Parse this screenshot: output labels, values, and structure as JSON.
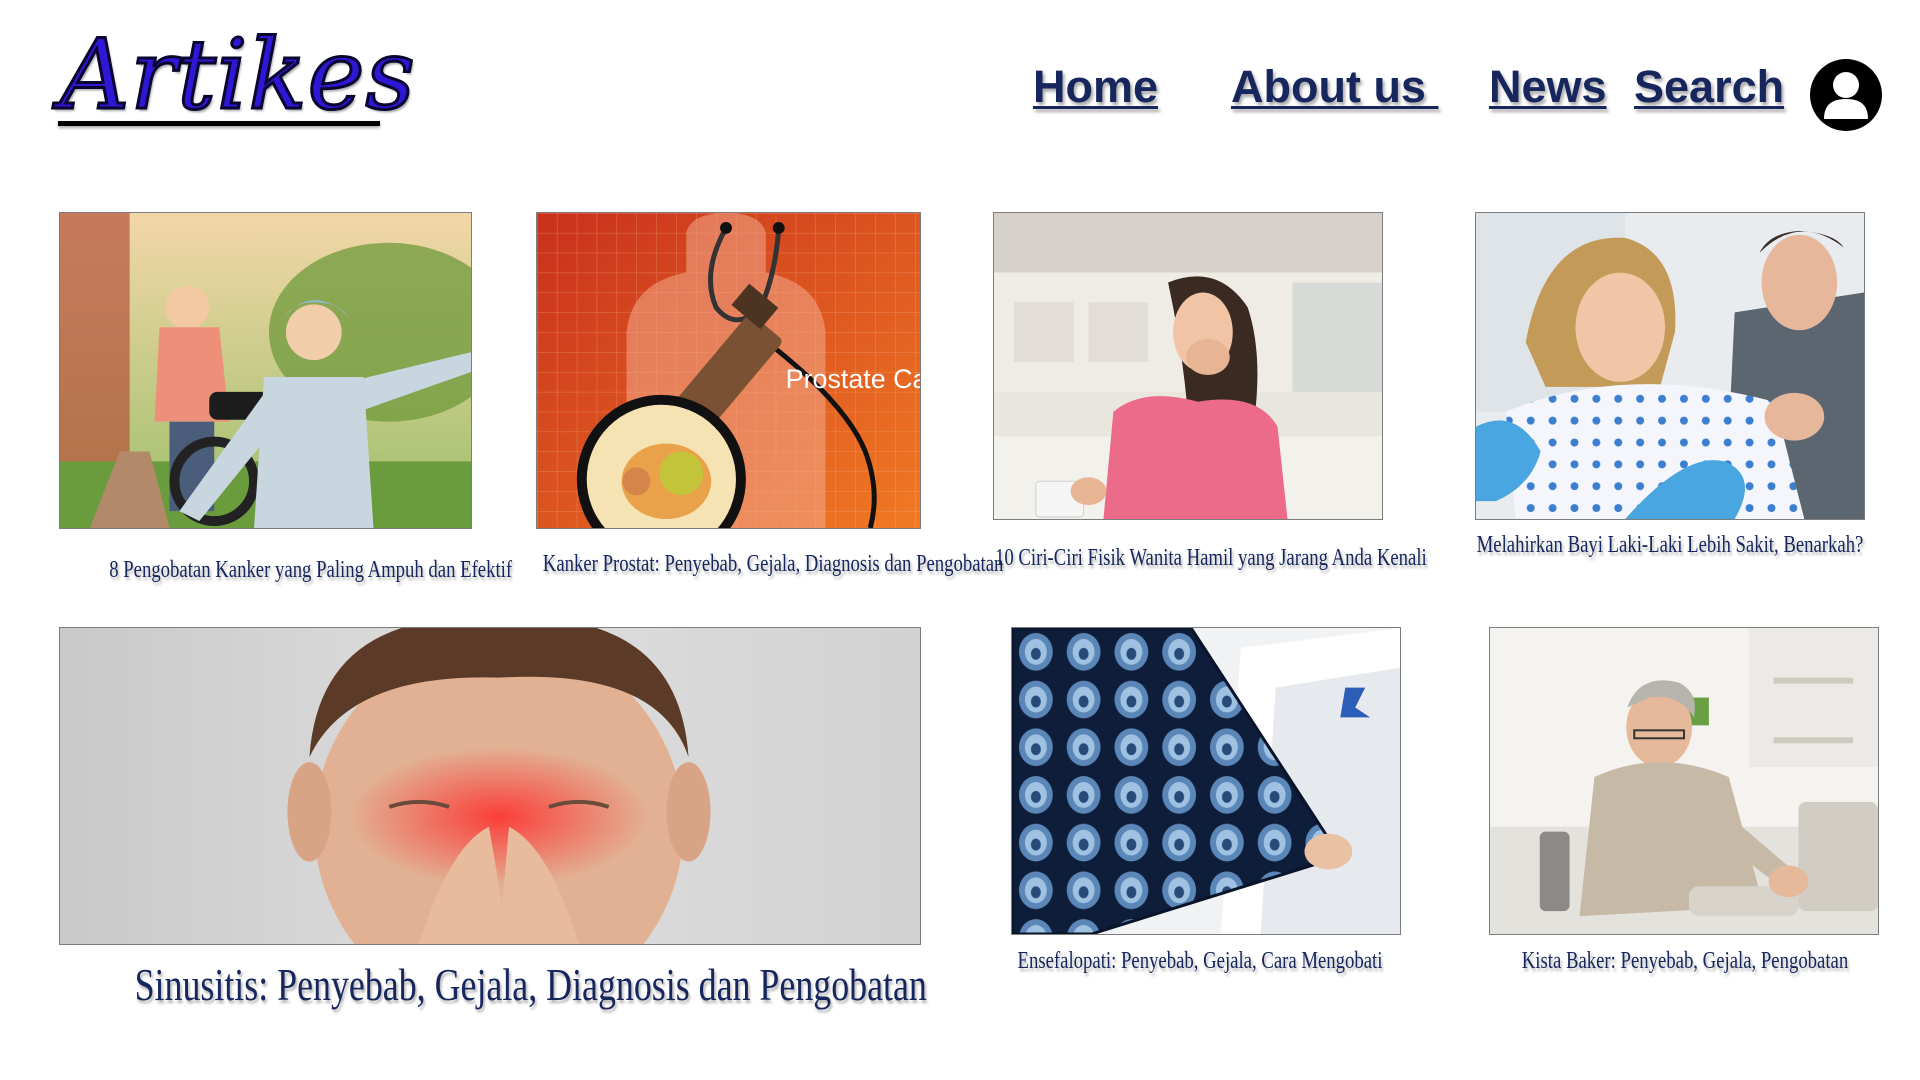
{
  "header": {
    "logo_text": "Artikes",
    "nav": {
      "home": "Home",
      "about": "About us ",
      "news": "News",
      "search": "Search"
    },
    "user_icon": "user-avatar-icon"
  },
  "articles": [
    {
      "title": "8 Pengobatan Kanker yang Paling Ampuh dan Efektif"
    },
    {
      "title": "Kanker Prostat: Penyebab, Gejala, Diagnosis dan Pengobatan",
      "image_caption": "Prostate Ca"
    },
    {
      "title": "10 Ciri-Ciri Fisik Wanita Hamil yang Jarang Anda Kenali"
    },
    {
      "title": "Melahirkan Bayi Laki-Laki Lebih Sakit, Benarkah?"
    },
    {
      "title": "Sinusitis: Penyebab, Gejala, Diagnosis dan Pengobatan"
    },
    {
      "title": "Ensefalopati: Penyebab, Gejala, Cara Mengobati"
    },
    {
      "title": "Kista Baker: Penyebab, Gejala, Pengobatan"
    }
  ],
  "colors": {
    "nav_text": "#17275e",
    "logo_fill": "#2f17d6",
    "logo_outline": "#0b0630",
    "card_border": "#7d7d7d"
  }
}
